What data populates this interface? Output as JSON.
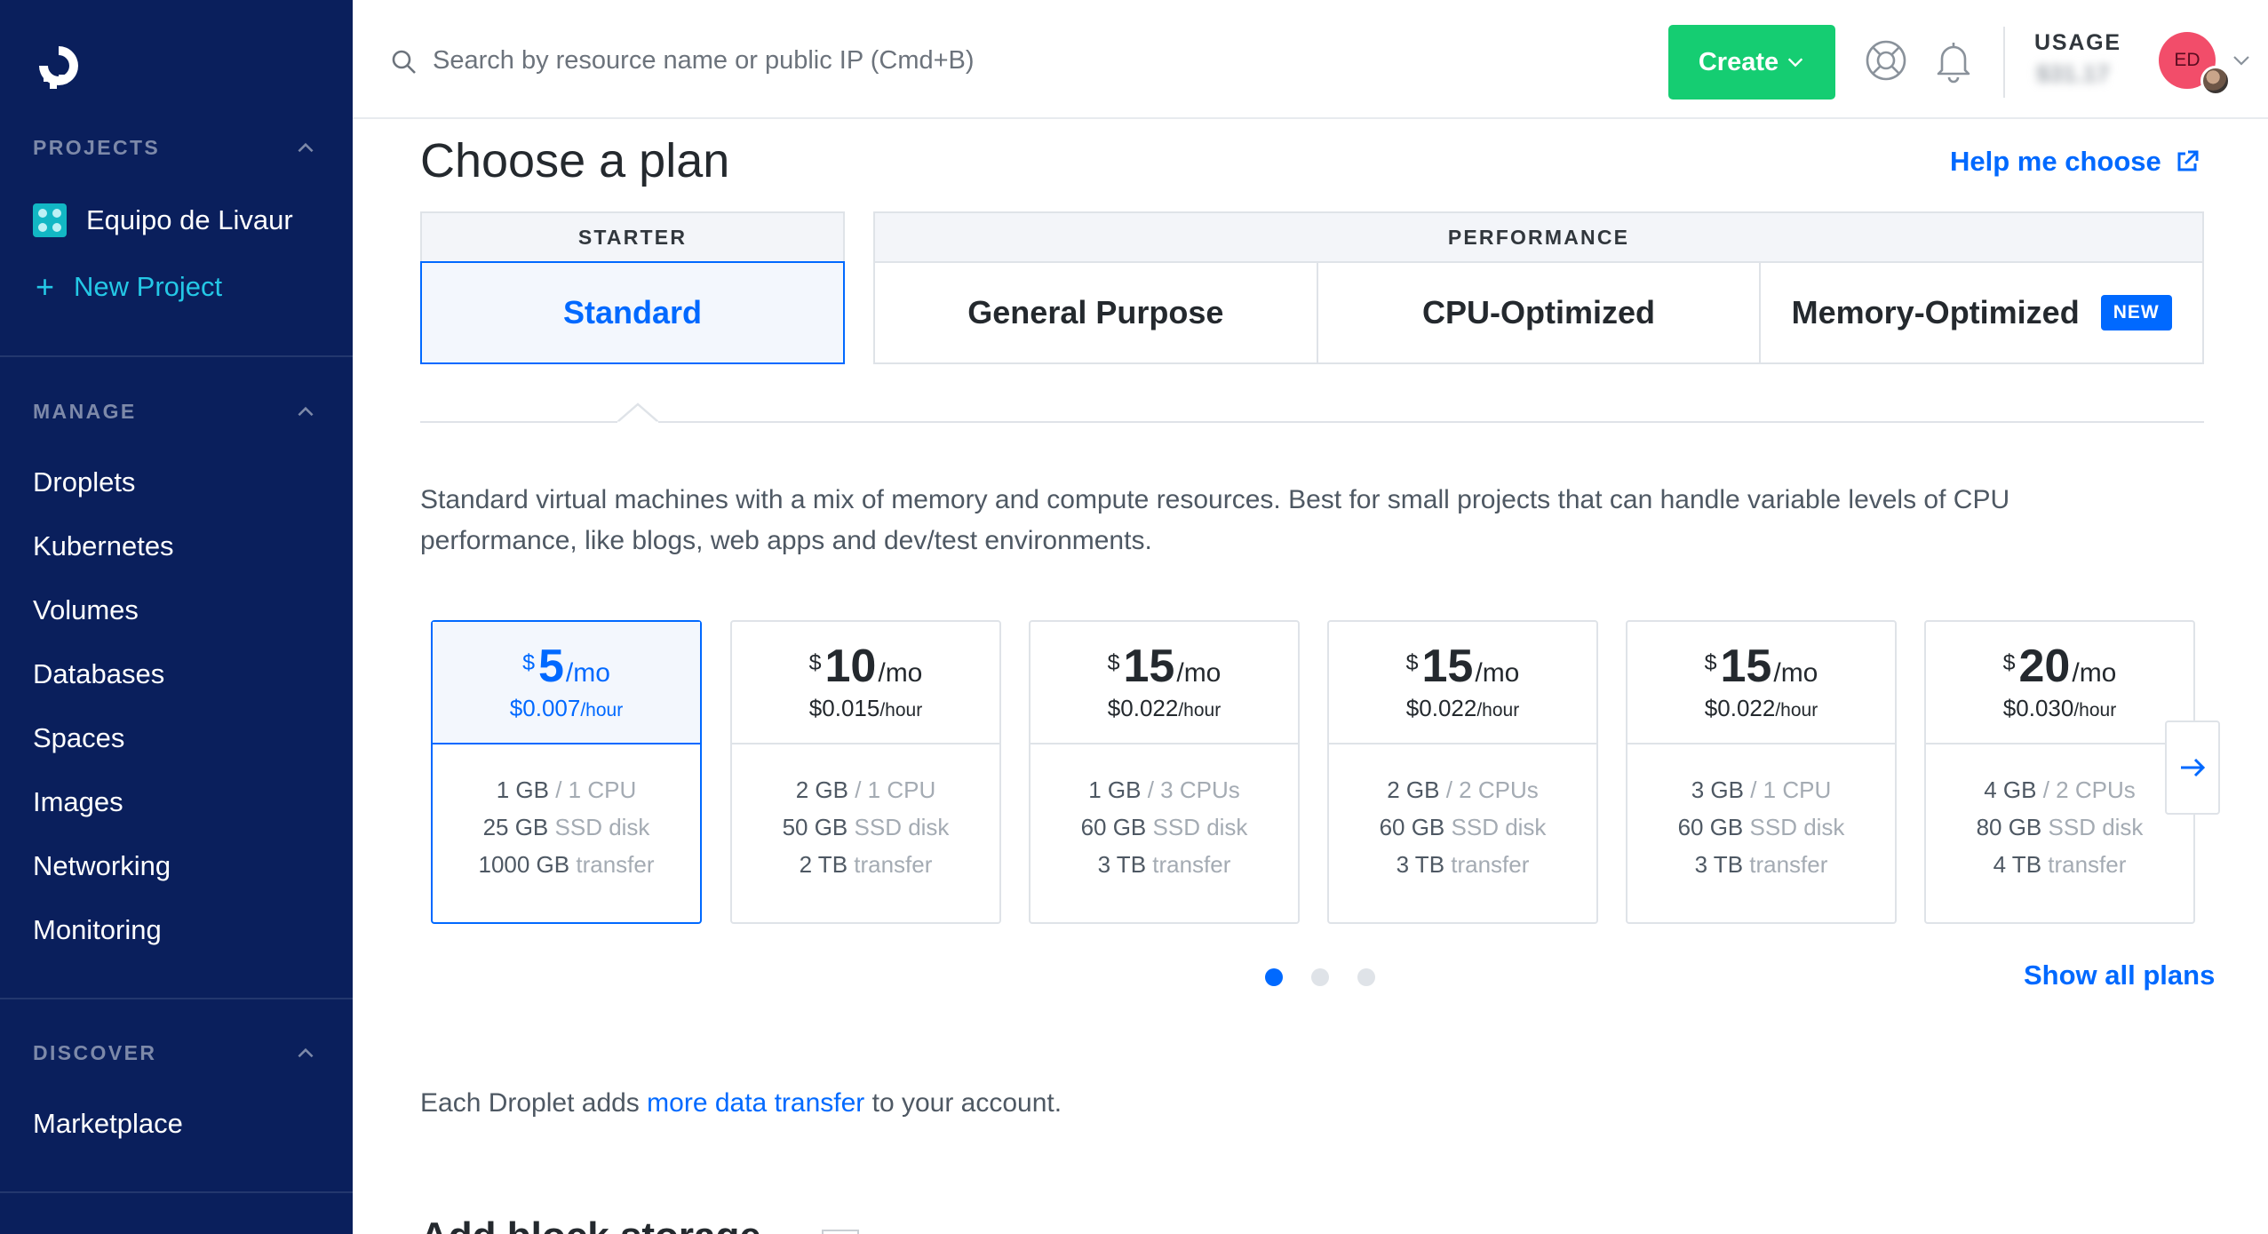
{
  "sidebar": {
    "projects_heading": "PROJECTS",
    "project_name": "Equipo de Livaur",
    "new_project": "New Project",
    "manage_heading": "MANAGE",
    "manage_items": [
      "Droplets",
      "Kubernetes",
      "Volumes",
      "Databases",
      "Spaces",
      "Images",
      "Networking",
      "Monitoring"
    ],
    "discover_heading": "DISCOVER",
    "discover_items": [
      "Marketplace"
    ]
  },
  "topbar": {
    "search_placeholder": "Search by resource name or public IP (Cmd+B)",
    "create_label": "Create",
    "usage_label": "USAGE",
    "usage_value": "$31.17",
    "avatar_initials": "ED"
  },
  "main": {
    "title": "Choose a plan",
    "help_link": "Help me choose",
    "groups": {
      "starter": {
        "label": "STARTER",
        "tabs": [
          "Standard"
        ]
      },
      "performance": {
        "label": "PERFORMANCE",
        "tabs": [
          "General Purpose",
          "CPU-Optimized",
          "Memory-Optimized"
        ],
        "new_badge": "NEW"
      }
    },
    "active_tab": "Standard",
    "description": "Standard virtual machines with a mix of memory and compute resources. Best for small projects that can handle variable levels of CPU performance, like blogs, web apps and dev/test environments.",
    "plans": [
      {
        "currency": "$",
        "price": "5",
        "per": "/mo",
        "hourly": "$0.007",
        "hour_unit": "/hour",
        "mem": "1 GB",
        "cpu": " / 1 CPU",
        "disk": "25 GB",
        "disk_unit": " SSD disk",
        "transfer": "1000 GB",
        "transfer_unit": " transfer"
      },
      {
        "currency": "$",
        "price": "10",
        "per": "/mo",
        "hourly": "$0.015",
        "hour_unit": "/hour",
        "mem": "2 GB",
        "cpu": " / 1 CPU",
        "disk": "50 GB",
        "disk_unit": " SSD disk",
        "transfer": "2 TB",
        "transfer_unit": " transfer"
      },
      {
        "currency": "$",
        "price": "15",
        "per": "/mo",
        "hourly": "$0.022",
        "hour_unit": "/hour",
        "mem": "1 GB",
        "cpu": " / 3 CPUs",
        "disk": "60 GB",
        "disk_unit": " SSD disk",
        "transfer": "3 TB",
        "transfer_unit": " transfer"
      },
      {
        "currency": "$",
        "price": "15",
        "per": "/mo",
        "hourly": "$0.022",
        "hour_unit": "/hour",
        "mem": "2 GB",
        "cpu": " / 2 CPUs",
        "disk": "60 GB",
        "disk_unit": " SSD disk",
        "transfer": "3 TB",
        "transfer_unit": " transfer"
      },
      {
        "currency": "$",
        "price": "15",
        "per": "/mo",
        "hourly": "$0.022",
        "hour_unit": "/hour",
        "mem": "3 GB",
        "cpu": " / 1 CPU",
        "disk": "60 GB",
        "disk_unit": " SSD disk",
        "transfer": "3 TB",
        "transfer_unit": " transfer"
      },
      {
        "currency": "$",
        "price": "20",
        "per": "/mo",
        "hourly": "$0.030",
        "hour_unit": "/hour",
        "mem": "4 GB",
        "cpu": " / 2 CPUs",
        "disk": "80 GB",
        "disk_unit": " SSD disk",
        "transfer": "4 TB",
        "transfer_unit": " transfer"
      }
    ],
    "selected_plan": 0,
    "pagination": {
      "pages": 3,
      "current": 1
    },
    "show_all": "Show all plans",
    "transfer_note": {
      "before": "Each Droplet adds ",
      "link": "more data transfer",
      "after": " to your account."
    },
    "next_section_title": "Add block storage"
  },
  "colors": {
    "sidebar_bg": "#0a1f5c",
    "accent": "#0069ff",
    "create": "#15cd72",
    "avatar": "#f24d6a"
  },
  "icons": [
    "logo-icon",
    "chevron-up-icon",
    "plus-icon",
    "search-icon",
    "chevron-down-icon",
    "help-lifebuoy-icon",
    "bell-icon",
    "external-link-icon",
    "arrow-right-icon"
  ]
}
